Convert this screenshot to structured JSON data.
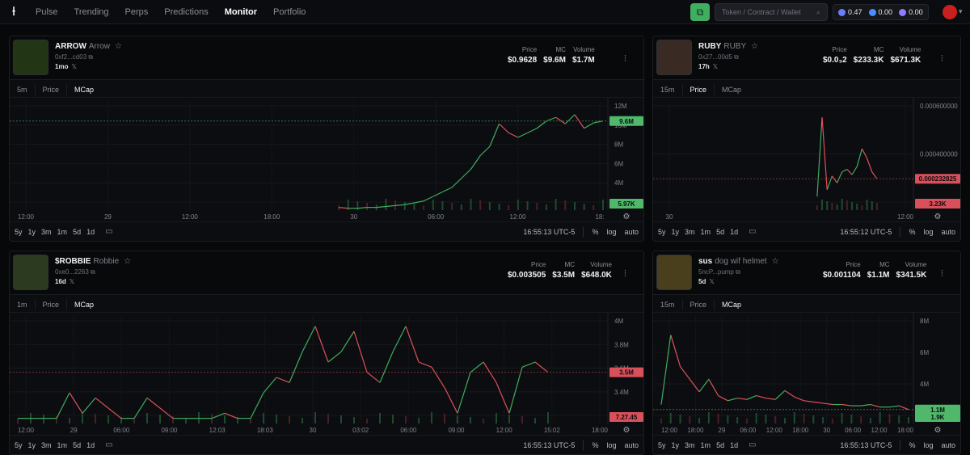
{
  "nav": {
    "items": [
      "Pulse",
      "Trending",
      "Perps",
      "Predictions",
      "Monitor",
      "Portfolio"
    ],
    "active": "Monitor"
  },
  "search": {
    "placeholder": "Token / Contract / Wallet"
  },
  "balances": [
    {
      "value": "0.47",
      "color": "#6c7bff"
    },
    {
      "value": "0.00",
      "color": "#4a8dff"
    },
    {
      "value": "0.00",
      "color": "#8f7bff"
    }
  ],
  "colors": {
    "up": "#3fae5f",
    "down": "#e0505a",
    "accent": "#3fae5f"
  },
  "panels": [
    {
      "name": "ARROW",
      "sub": "Arrow",
      "addr": "0xf2...cd03",
      "age": "1mo",
      "stat_labels": [
        "Price",
        "MC",
        "Volume"
      ],
      "stats": [
        "$0.9628",
        "$9.6M",
        "$1.7M"
      ],
      "tabs": [
        "5m",
        "Price",
        "MCap"
      ],
      "active_tab": "MCap",
      "ranges": [
        "5y",
        "1y",
        "3m",
        "1m",
        "5d",
        "1d"
      ],
      "clock": "16:55:13 UTC-5",
      "opts": [
        "%",
        "log",
        "auto"
      ],
      "chart_data": {
        "type": "line",
        "x_labels": [
          "12:00",
          "29",
          "12:00",
          "18:00",
          "30",
          "06:00",
          "12:00",
          "18:"
        ],
        "y_ticks": [
          "12M",
          "10M",
          "8M",
          "6M",
          "4M",
          "2M"
        ],
        "ylim": [
          0,
          12
        ],
        "series": [
          {
            "values": [
              0.3,
              0.2,
              0.2,
              0.3,
              0.3,
              0.4,
              0.5,
              0.6,
              0.8,
              1.0,
              1.5,
              2.0,
              2.5,
              3.5,
              4.5,
              6.0,
              7.0,
              9.5,
              8.5,
              8.0,
              8.5,
              9.0,
              9.8,
              10.2,
              9.5,
              10.5,
              9.0,
              9.6,
              9.8
            ]
          }
        ],
        "price_label": "9.6M",
        "volume_label": "5.97K"
      }
    },
    {
      "name": "RUBY",
      "sub": "RUBY",
      "addr": "0x27...00d5",
      "age": "17h",
      "stat_labels": [
        "Price",
        "MC",
        "Volume"
      ],
      "stats": [
        "$0.0₃2",
        "$233.3K",
        "$671.3K"
      ],
      "tabs": [
        "15m",
        "Price",
        "MCap"
      ],
      "active_tab": "Price",
      "ranges": [
        "5y",
        "1y",
        "3m",
        "1m",
        "5d",
        "1d"
      ],
      "clock": "16:55:12 UTC-5",
      "opts": [
        "%",
        "log",
        "auto"
      ],
      "chart_data": {
        "type": "line",
        "x_labels": [
          "30",
          "12:00"
        ],
        "y_ticks": [
          "0.000600000",
          "0.000400000",
          "0.000200000"
        ],
        "ylim": [
          0,
          0.0008
        ],
        "series": [
          {
            "values": [
              0.0001,
              0.00068,
              0.00015,
              0.00025,
              0.0002,
              0.00028,
              0.0003,
              0.00026,
              0.00032,
              0.00045,
              0.00038,
              0.00028,
              0.00023
            ]
          }
        ],
        "price_label": "0.000232825",
        "volume_label": "3.23K"
      }
    },
    {
      "name": "$ROBBIE",
      "sub": "Robbie",
      "addr": "0xe0...2263",
      "age": "16d",
      "stat_labels": [
        "Price",
        "MC",
        "Volume"
      ],
      "stats": [
        "$0.003505",
        "$3.5M",
        "$648.0K"
      ],
      "tabs": [
        "1m",
        "Price",
        "MCap"
      ],
      "active_tab": "MCap",
      "ranges": [
        "5y",
        "1y",
        "3m",
        "1m",
        "5d",
        "1d"
      ],
      "clock": "16:55:13 UTC-5",
      "opts": [
        "%",
        "log",
        "auto"
      ],
      "chart_data": {
        "type": "line",
        "x_labels": [
          "12:00",
          "29",
          "06:00",
          "09:00",
          "12:03",
          "18:03",
          "30",
          "03:02",
          "06:00",
          "09:00",
          "12:00",
          "15:02",
          "18:00"
        ],
        "y_ticks": [
          "4M",
          "3.8M",
          "3.6M",
          "3.4M",
          "3.2M"
        ],
        "ylim": [
          3.0,
          4.05
        ],
        "series": [
          {
            "values": [
              3.05,
              3.05,
              3.05,
              3.05,
              3.3,
              3.1,
              3.25,
              3.15,
              3.05,
              3.05,
              3.25,
              3.15,
              3.05,
              3.05,
              3.05,
              3.05,
              3.1,
              3.05,
              3.05,
              3.3,
              3.45,
              3.4,
              3.7,
              3.95,
              3.6,
              3.7,
              3.9,
              3.5,
              3.4,
              3.7,
              3.95,
              3.6,
              3.55,
              3.35,
              3.1,
              3.5,
              3.6,
              3.4,
              3.1,
              3.55,
              3.6,
              3.5
            ]
          }
        ],
        "price_label": "3.5M",
        "volume_label": "7.27.45"
      }
    },
    {
      "name": "sus",
      "sub": "dog wif helmet",
      "addr": "5ncP...pump",
      "age": "5d",
      "stat_labels": [
        "Price",
        "MC",
        "Volume"
      ],
      "stats": [
        "$0.001104",
        "$1.1M",
        "$341.5K"
      ],
      "tabs": [
        "15m",
        "Price",
        "MCap"
      ],
      "active_tab": "MCap",
      "ranges": [
        "5y",
        "1y",
        "3m",
        "1m",
        "5d",
        "1d"
      ],
      "clock": "16:55:13 UTC-5",
      "opts": [
        "%",
        "log",
        "auto"
      ],
      "chart_data": {
        "type": "line",
        "x_labels": [
          "12:00",
          "18:00",
          "29",
          "06:00",
          "12:00",
          "18:00",
          "30",
          "06:00",
          "12:00",
          "18:00"
        ],
        "y_ticks": [
          "8M",
          "6M",
          "4M",
          "2M"
        ],
        "ylim": [
          0,
          8.5
        ],
        "series": [
          {
            "values": [
              1.5,
              7.0,
              4.5,
              3.5,
              2.5,
              3.5,
              2.2,
              1.8,
              2.0,
              1.9,
              2.2,
              2.0,
              1.9,
              2.6,
              2.1,
              1.8,
              1.7,
              1.6,
              1.5,
              1.5,
              1.4,
              1.4,
              1.5,
              1.3,
              1.3,
              1.4,
              1.1
            ]
          }
        ],
        "price_label": "1.1M",
        "volume_label": "1.9K"
      }
    }
  ]
}
